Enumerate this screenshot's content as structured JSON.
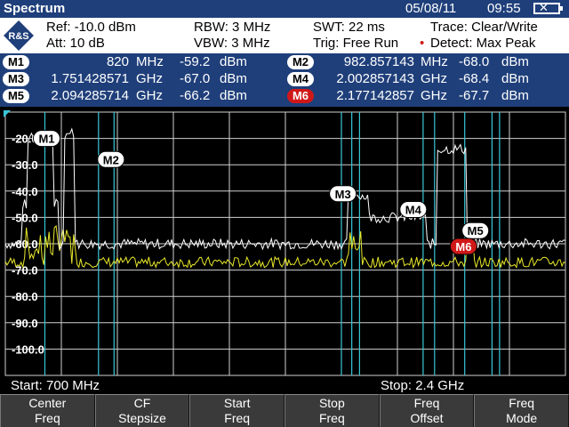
{
  "titlebar": {
    "title": "Spectrum",
    "date": "05/08/11",
    "time": "09:55"
  },
  "params": {
    "ref": "Ref:  -10.0 dBm",
    "att": "Att:  10 dB",
    "rbw": "RBW:  3 MHz",
    "vbw": "VBW:  3 MHz",
    "swt": "SWT:  22 ms",
    "trig": "Trig:  Free Run",
    "trace": "Trace:  Clear/Write",
    "detect": "Detect:  Max Peak",
    "detect_dot": "•"
  },
  "markers": [
    {
      "id": "M1",
      "freq": "820",
      "unit": "MHz",
      "level": "-59.2",
      "lunit": "dBm",
      "active": false
    },
    {
      "id": "M2",
      "freq": "982.857143",
      "unit": "MHz",
      "level": "-68.0",
      "lunit": "dBm",
      "active": false
    },
    {
      "id": "M3",
      "freq": "1.751428571",
      "unit": "GHz",
      "level": "-67.0",
      "lunit": "dBm",
      "active": false
    },
    {
      "id": "M4",
      "freq": "2.002857143",
      "unit": "GHz",
      "level": "-68.4",
      "lunit": "dBm",
      "active": false
    },
    {
      "id": "M5",
      "freq": "2.094285714",
      "unit": "GHz",
      "level": "-66.2",
      "lunit": "dBm",
      "active": false
    },
    {
      "id": "M6",
      "freq": "2.177142857",
      "unit": "GHz",
      "level": "-67.7",
      "lunit": "dBm",
      "active": true
    }
  ],
  "plot": {
    "y_labels": [
      "-20.0",
      "-30.0",
      "-40.0",
      "-50.0",
      "-60.0",
      "-70.0",
      "-80.0",
      "-90.0",
      "-100.0"
    ],
    "start": "Start:  700 MHz",
    "stop": "Stop: 2.4 GHz"
  },
  "softkeys": [
    {
      "l1": "Center",
      "l2": "Freq"
    },
    {
      "l1": "CF",
      "l2": "Stepsize"
    },
    {
      "l1": "Start",
      "l2": "Freq"
    },
    {
      "l1": "Stop",
      "l2": "Freq"
    },
    {
      "l1": "Freq",
      "l2": "Offset"
    },
    {
      "l1": "Freq",
      "l2": "Mode"
    }
  ],
  "colors": {
    "header_bg": "#1f3f7a",
    "grid": "#d0d0d0",
    "trace_white": "#ffffff",
    "trace_yellow": "#e8e82a",
    "marker_line": "#38c8d8",
    "active_marker": "#d01818"
  }
}
